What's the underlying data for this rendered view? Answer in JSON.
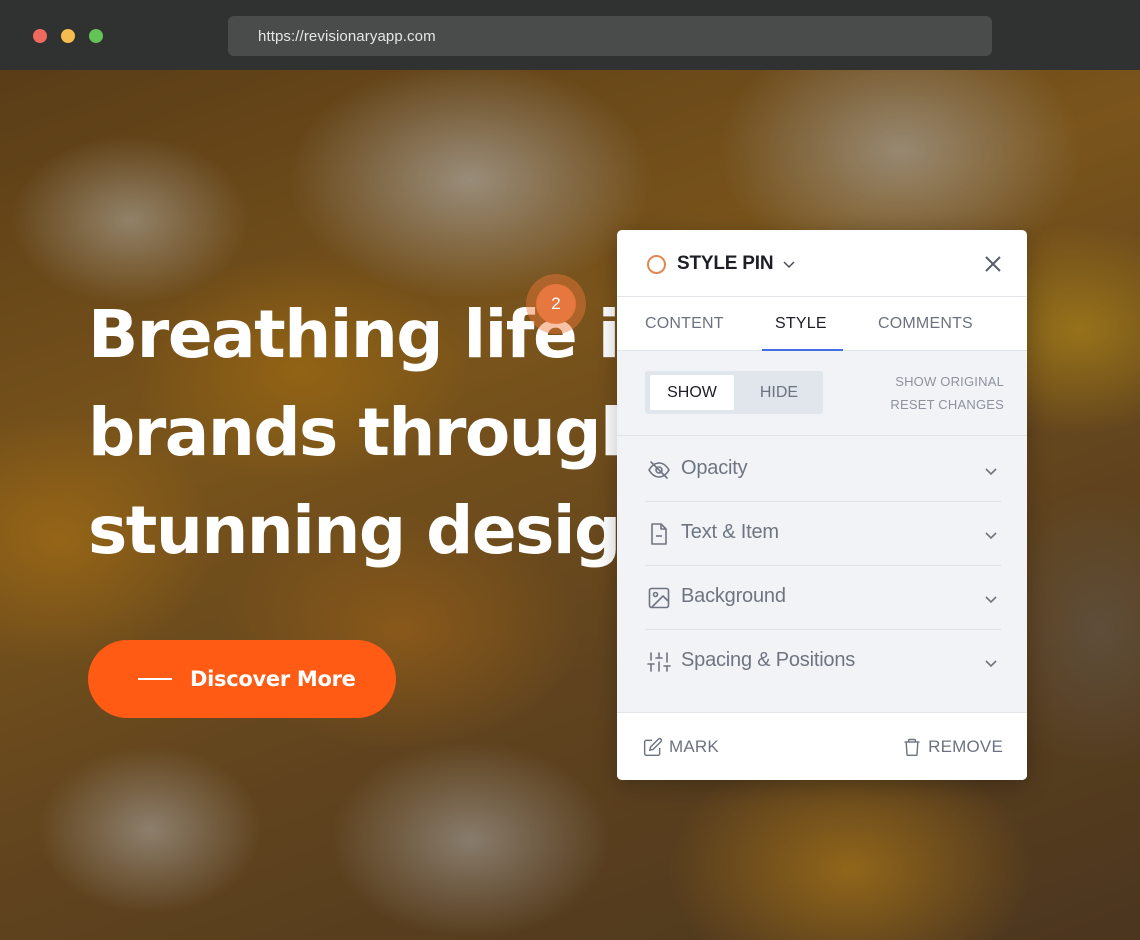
{
  "browser": {
    "url": "https://revisionaryapp.com"
  },
  "hero": {
    "headline_lines": [
      "Breathing life in",
      "brands through",
      "stunning design"
    ],
    "cta_label": "Discover More",
    "pin_number": "2"
  },
  "panel": {
    "title": "STYLE PIN",
    "tabs": [
      {
        "label": "CONTENT",
        "active": false
      },
      {
        "label": "STYLE",
        "active": true
      },
      {
        "label": "COMMENTS",
        "active": false
      }
    ],
    "toggle": {
      "show_label": "SHOW",
      "hide_label": "HIDE",
      "selected": "SHOW"
    },
    "links": {
      "show_original": "SHOW ORIGINAL",
      "reset_changes": "RESET CHANGES"
    },
    "sections": [
      {
        "label": "Opacity",
        "icon": "eye-off-icon"
      },
      {
        "label": "Text & Item",
        "icon": "file-icon"
      },
      {
        "label": "Background",
        "icon": "image-icon"
      },
      {
        "label": "Spacing & Positions",
        "icon": "sliders-icon"
      }
    ],
    "footer": {
      "mark_label": "MARK",
      "remove_label": "REMOVE"
    }
  },
  "colors": {
    "accent_orange": "#ff5b14",
    "pin_orange": "#e5773f",
    "tab_active_underline": "#3f6fe0"
  }
}
